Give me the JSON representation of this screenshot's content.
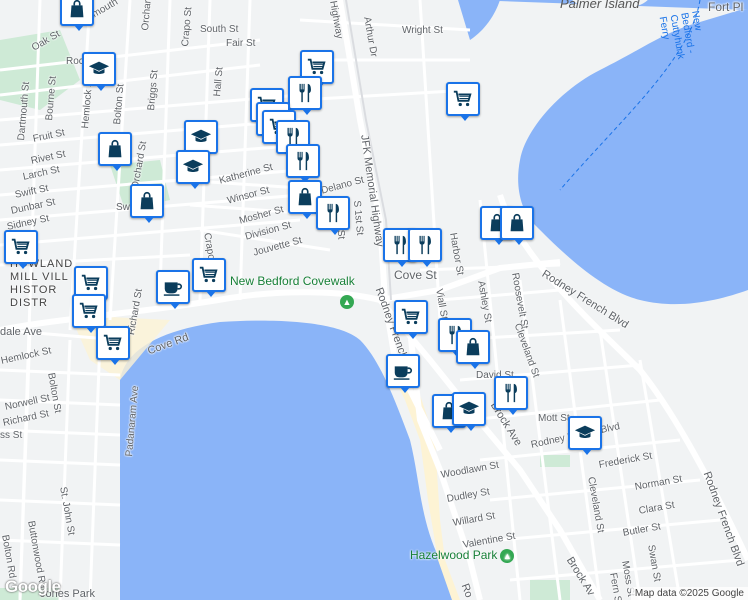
{
  "map": {
    "colors": {
      "land": "#f1f3f4",
      "water": "#8ab4f8",
      "park": "#ceead6",
      "sand": "#fdf3d4",
      "road": "#ffffff",
      "hwy": "#dadce0",
      "pin": "#1a73e8"
    },
    "streets": {
      "oak": "Oak St",
      "dartmouth_top": "Dartmouth",
      "rock": "Rock St",
      "crapo_top": "Crapo St",
      "orchard_top": "Orchard St",
      "south": "South St",
      "fair": "Fair St",
      "wright": "Wright St",
      "arthur": "Arthur Dr",
      "jfk_top": "Highway",
      "dartmouth_left": "Dartmouth St",
      "bourne": "Bourne St",
      "hemlock_top": "Hemlock St",
      "bolton_top": "Bolton St",
      "briggs": "Briggs St",
      "hall": "Hall St",
      "fruit": "Fruit St",
      "rivet": "Rivet St",
      "larch": "Larch St",
      "swift": "Swift St",
      "dunbar": "Dunbar St",
      "sidney": "Sidney St",
      "orchard_mid": "Orchard St",
      "sw": "Sw",
      "katherine": "Katherine St",
      "winsor": "Winsor St",
      "mosher": "Mosher St",
      "delano": "Delano St",
      "division": "Division St",
      "jouvette": "Jouvette St",
      "crapo_mid": "Crapo St",
      "first": "S 1st St",
      "second": "2nd St",
      "jfk": "JFK Memorial Highway",
      "cove_st": "Cove St",
      "rodney_french_upper": "Rodney French Blvd",
      "harbor": "Harbor St",
      "ashley": "Ashley St",
      "roosevelt_upper": "Roosevelt St",
      "viall": "Viall St",
      "cleveland_upper": "Cleveland St",
      "david": "David St",
      "mott": "Mott St",
      "rodney_lower": "Rodney French Blvd",
      "brock": "Brock Ave",
      "brock_lower": "Brock Av",
      "woodlawn": "Woodlawn St",
      "dudley": "Dudley St",
      "willard": "Willard St",
      "valentine": "Valentine St",
      "frederick": "Frederick St",
      "norman": "Norman St",
      "clara": "Clara St",
      "butler": "Butler St",
      "cleveland_lower": "Cleveland St",
      "swan": "Swan St",
      "moss": "Moss St",
      "fern": "Fern St",
      "rodney_right": "Rodney French Blvd",
      "cove_rd": "Cove Rd",
      "dale_ave": "dale Ave",
      "hemlock_lower": "Hemlock St",
      "bolton_lower": "Bolton St",
      "norwell": "Norwell St",
      "richard": "Richard St",
      "ss": "ss St",
      "st_john": "St. John St",
      "padanaram": "Padanaram Ave",
      "buttonwood": "Buttonwood Rd",
      "bolton_rd": "Bolton Rd",
      "richard_v": "Richard St",
      "ro": "Ro",
      "rodney_bottom": "Rodney French Blvd",
      "rodney_mid": "Rodney French"
    },
    "district_lines": [
      "HOWLAND",
      "MILL VILL",
      "HISTOR",
      "DISTR"
    ],
    "pois": {
      "covewalk": "New Bedford Covewalk",
      "hazelwood": "Hazelwood Park",
      "palmer": "Palmer Island",
      "fort": "Fort Pl",
      "ferry": "New Bedford - Cuttyhunk Ferry",
      "jones": "Jones Park"
    },
    "pins": [
      {
        "type": "shopping-bag",
        "icon": "shopping-bag-icon"
      },
      {
        "type": "school",
        "icon": "graduation-cap-icon"
      },
      {
        "type": "grocery",
        "icon": "shopping-cart-icon"
      },
      {
        "type": "restaurant",
        "icon": "fork-knife-icon"
      },
      {
        "type": "cafe",
        "icon": "coffee-cup-icon"
      }
    ],
    "google_logo": "Google",
    "attribution": "Map data ©2025 Google"
  }
}
